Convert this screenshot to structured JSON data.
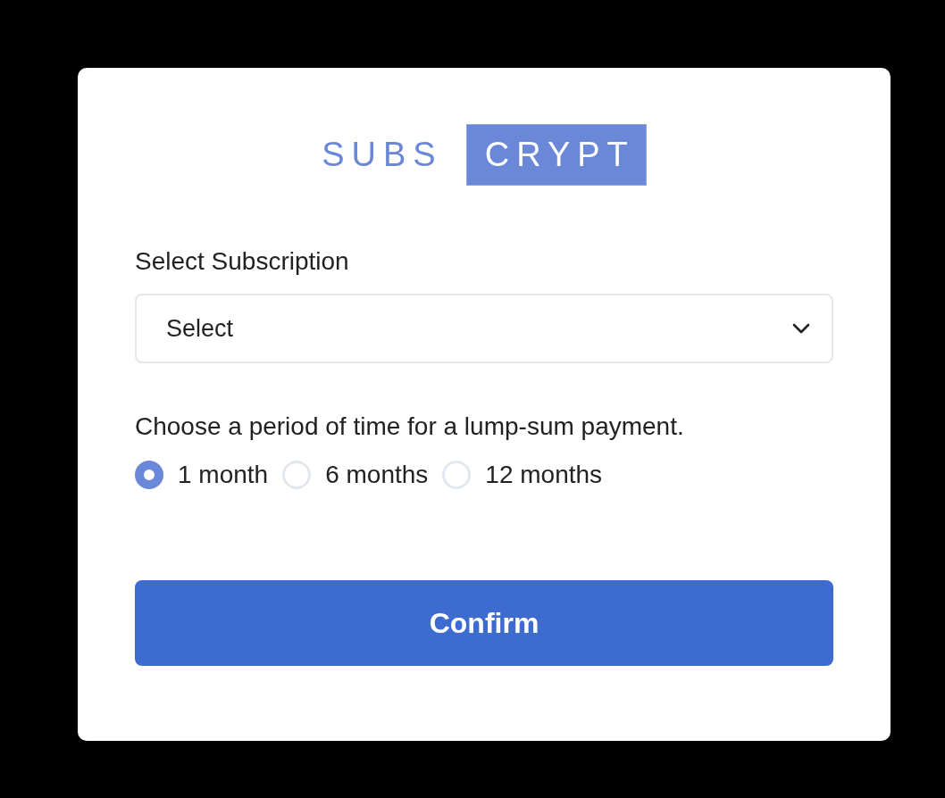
{
  "logo": {
    "part_1": "SUBS",
    "part_2": "CRYPT"
  },
  "subscription": {
    "label": "Select Subscription",
    "value": "Select"
  },
  "period": {
    "prompt": "Choose a period of time for a lump-sum payment.",
    "options": [
      {
        "label": "1 month",
        "selected": true
      },
      {
        "label": "6 months",
        "selected": false
      },
      {
        "label": "12 months",
        "selected": false
      }
    ]
  },
  "confirm_button": "Confirm"
}
